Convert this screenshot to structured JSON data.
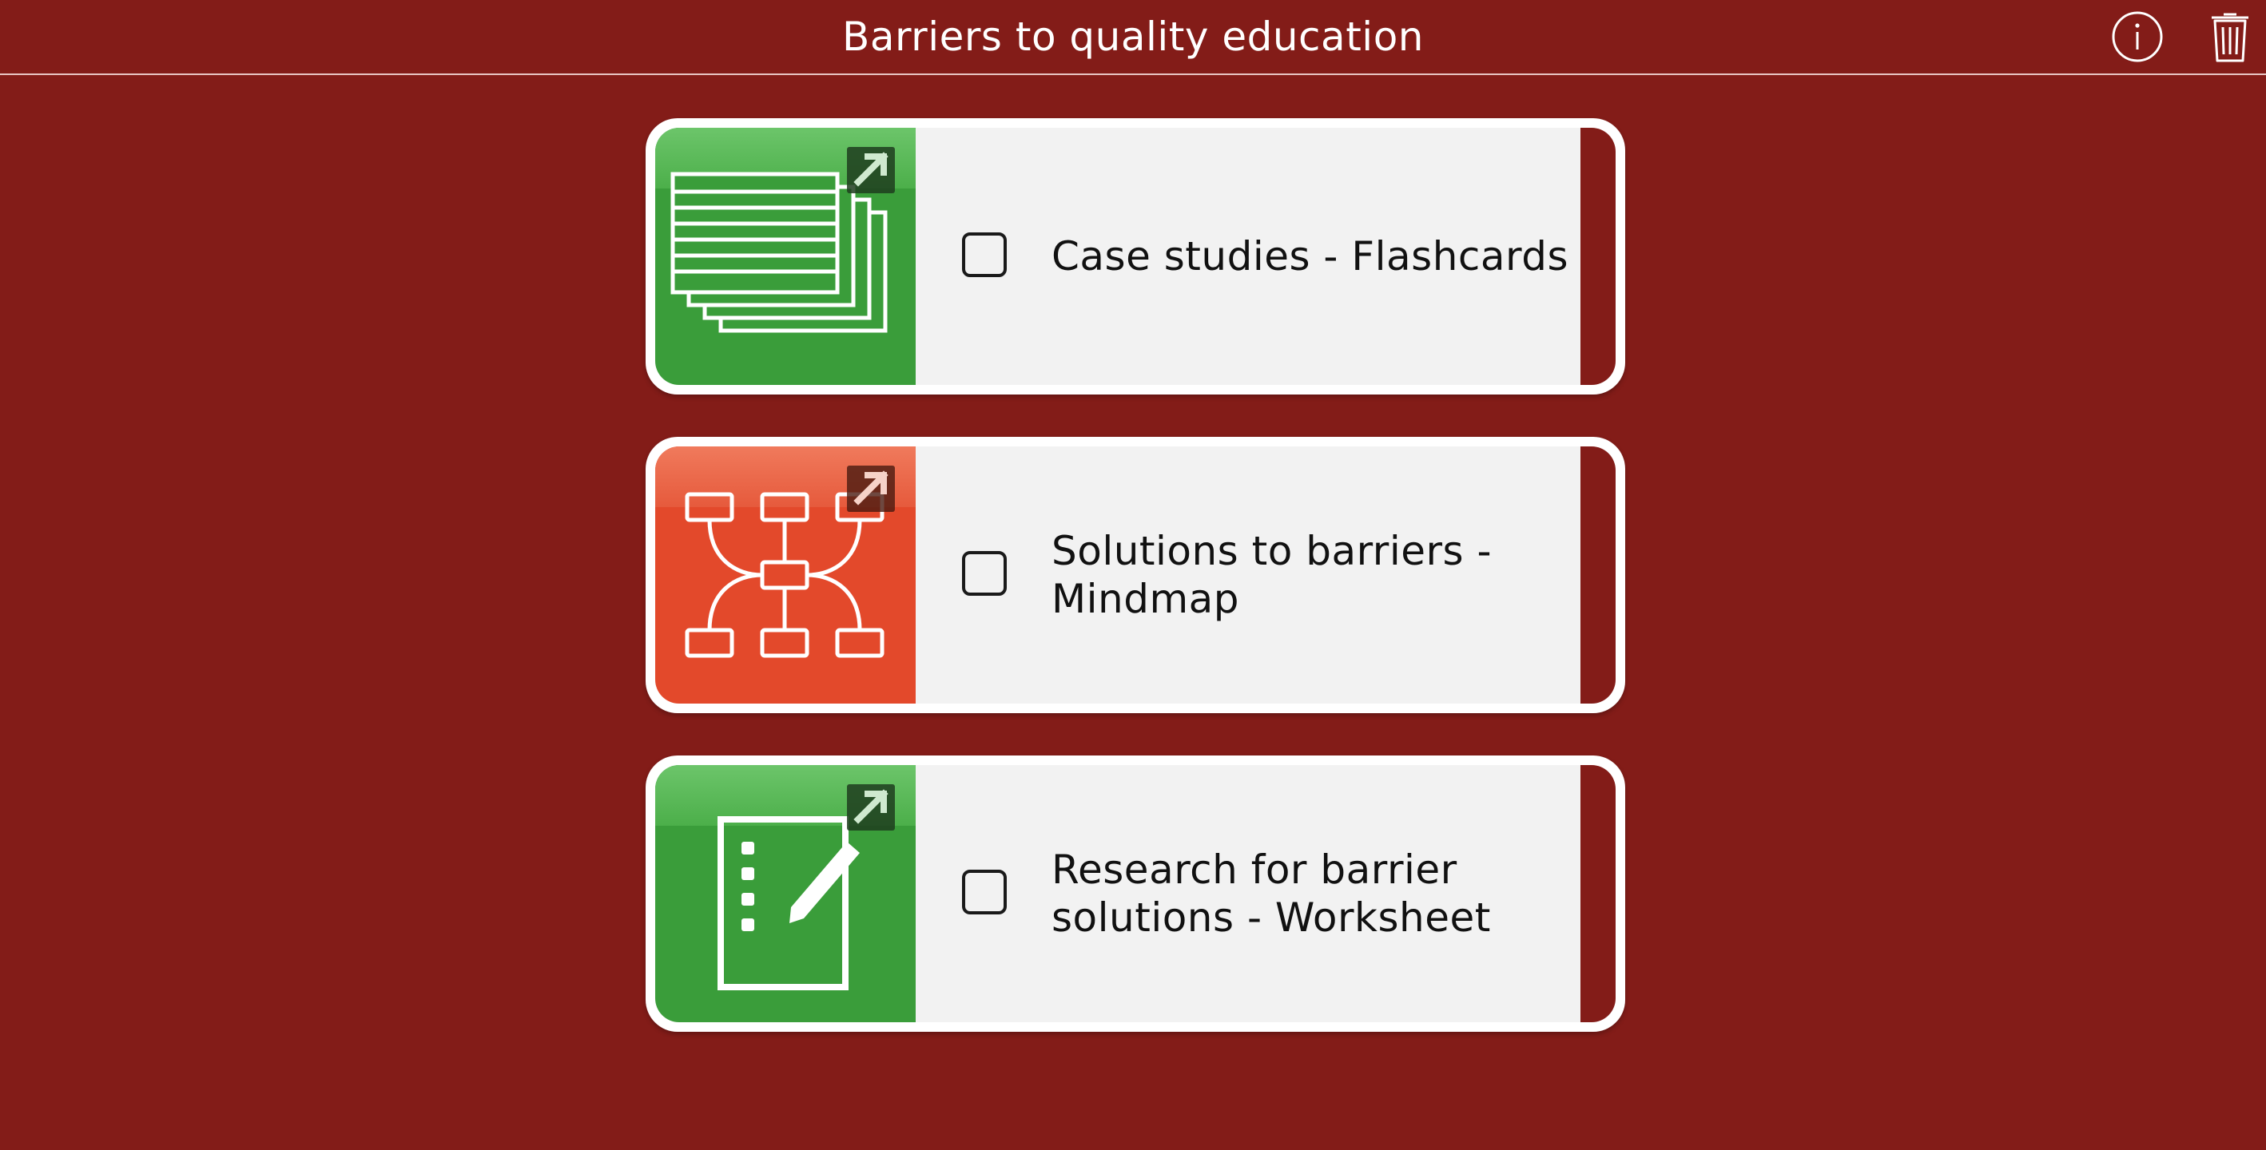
{
  "header": {
    "title": "Barriers to quality education",
    "info_icon": "info-icon",
    "trash_icon": "trash-icon"
  },
  "colors": {
    "background": "#831c18",
    "flashcards_tile": "#3a9d3a",
    "mindmap_tile": "#e3492b",
    "worksheet_tile": "#3a9d3a",
    "card_body": "#f2f2f2"
  },
  "activities": [
    {
      "label": "Case studies - Flashcards",
      "icon": "flashcards-icon",
      "checked": false
    },
    {
      "label": "Solutions to barriers - Mindmap",
      "icon": "mindmap-icon",
      "checked": false
    },
    {
      "label": "Research for barrier solutions - Worksheet",
      "icon": "worksheet-icon",
      "checked": false
    }
  ]
}
